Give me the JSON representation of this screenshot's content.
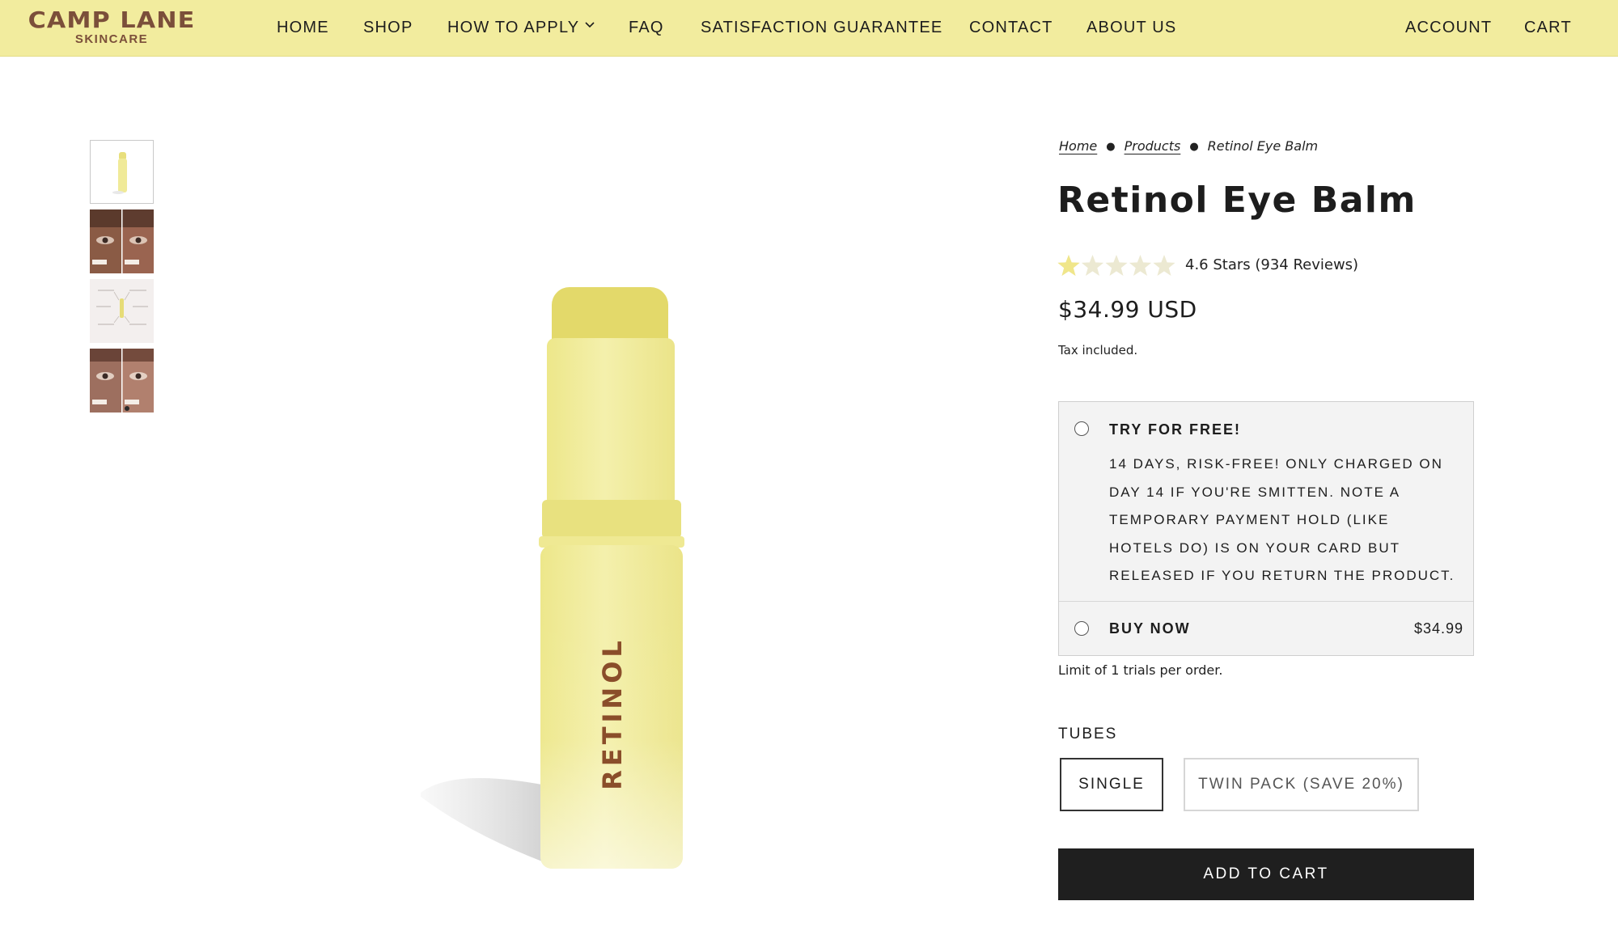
{
  "brand": {
    "name": "CAMP LANE",
    "tagline": "SKINCARE"
  },
  "nav": {
    "items": [
      "HOME",
      "SHOP",
      "HOW TO APPLY",
      "FAQ",
      "SATISFACTION GUARANTEE",
      "CONTACT",
      "ABOUT US"
    ],
    "account": "ACCOUNT",
    "cart": "CART"
  },
  "breadcrumb": {
    "home": "Home",
    "products": "Products",
    "current": "Retinol Eye Balm"
  },
  "product": {
    "title": "Retinol Eye Balm",
    "rating": 4.6,
    "rating_max": 5,
    "rating_text": "4.6 Stars (934 Reviews)",
    "price": "$34.99 USD",
    "tax_note": "Tax included.",
    "label_on_tube": "RETINOL"
  },
  "purchase_options": {
    "trial": {
      "title": "TRY FOR FREE!",
      "description": "14 DAYS, RISK-FREE! ONLY CHARGED ON DAY 14 IF YOU'RE SMITTEN. NOTE A TEMPORARY PAYMENT HOLD (LIKE HOTELS DO) IS ON YOUR CARD BUT RELEASED IF YOU RETURN THE PRODUCT."
    },
    "buy_now": {
      "title": "BUY NOW",
      "price": "$34.99"
    },
    "limit_note": "Limit of 1 trials per order."
  },
  "tubes": {
    "label": "TUBES",
    "options": [
      "SINGLE",
      "TWIN PACK (SAVE 20%)"
    ],
    "selected": "SINGLE"
  },
  "add_to_cart": "ADD TO CART",
  "colors": {
    "header_bg": "#f2ec9e",
    "brand": "#7b4f3a",
    "star": "#f0e68a",
    "button_bg": "#1f1f1f"
  }
}
